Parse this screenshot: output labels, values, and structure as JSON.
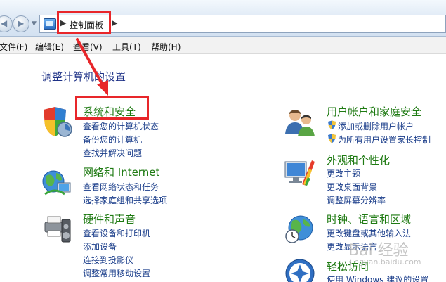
{
  "address_bar": {
    "breadcrumb": "控制面板"
  },
  "menu": {
    "items": [
      "文件(F)",
      "编辑(E)",
      "查看(V)",
      "工具(T)",
      "帮助(H)"
    ]
  },
  "main": {
    "title": "调整计算机的设置",
    "categories": [
      {
        "title": "系统和安全",
        "links": [
          "查看您的计算机状态",
          "备份您的计算机",
          "查找并解决问题"
        ]
      },
      {
        "title": "网络和 Internet",
        "links": [
          "查看网络状态和任务",
          "选择家庭组和共享选项"
        ]
      },
      {
        "title": "硬件和声音",
        "links": [
          "查看设备和打印机",
          "添加设备",
          "连接到投影仪",
          "调整常用移动设置"
        ]
      },
      {
        "title": "用户帐户和家庭安全",
        "links": [
          "添加或删除用户帐户",
          "为所有用户设置家长控制"
        ]
      },
      {
        "title": "外观和个性化",
        "links": [
          "更改主题",
          "更改桌面背景",
          "调整屏幕分辨率"
        ]
      },
      {
        "title": "时钟、语言和区域",
        "links": [
          "更改键盘或其他输入法",
          "更改显示语言"
        ]
      },
      {
        "title": "轻松访问",
        "links": [
          "使用 Windows 建议的设置"
        ]
      }
    ]
  },
  "watermark": {
    "text": "Bai 经验",
    "sub": "jingyan.baidu.com"
  },
  "colors": {
    "highlight": "#e8262a",
    "category_title": "#1e7a12",
    "link": "#1a3d8a",
    "page_title": "#1e3287"
  }
}
